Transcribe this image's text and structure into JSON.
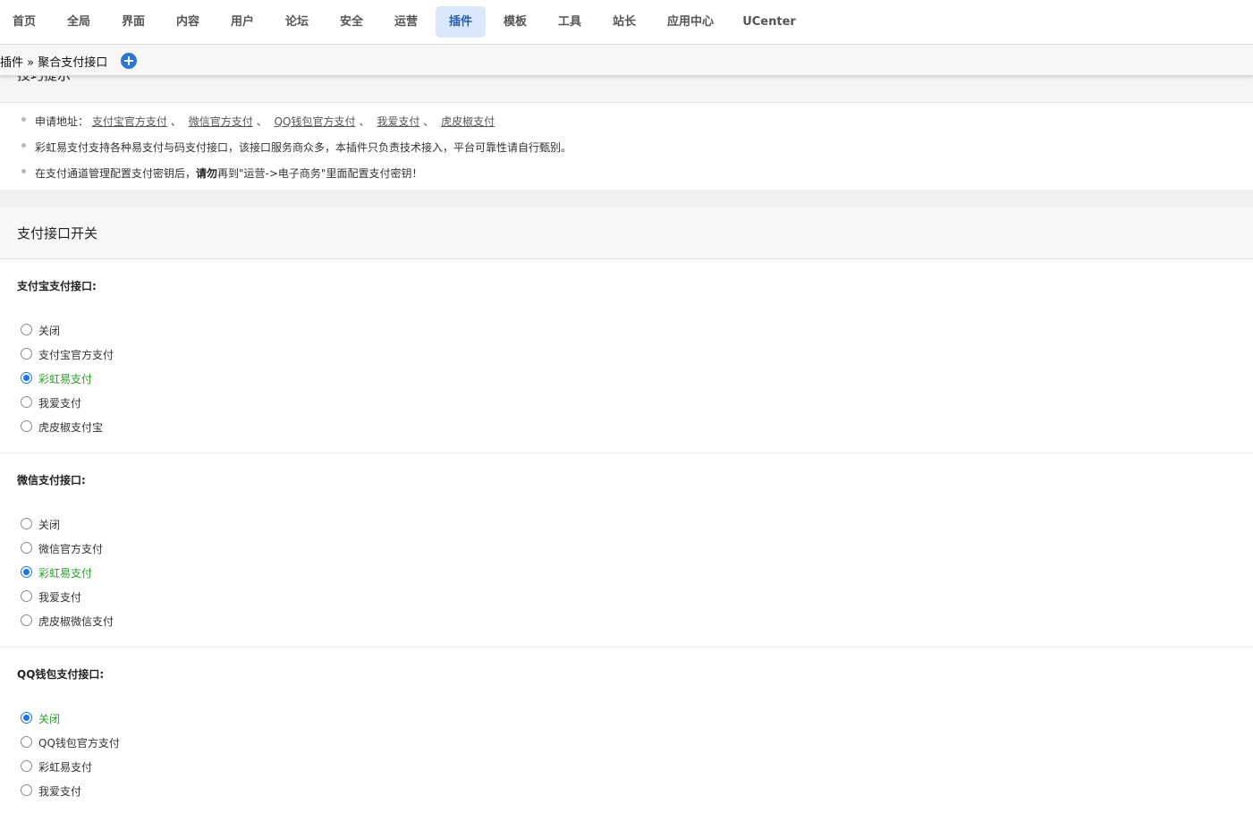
{
  "nav": {
    "items": [
      {
        "label": "首页",
        "active": false
      },
      {
        "label": "全局",
        "active": false
      },
      {
        "label": "界面",
        "active": false
      },
      {
        "label": "内容",
        "active": false
      },
      {
        "label": "用户",
        "active": false
      },
      {
        "label": "论坛",
        "active": false
      },
      {
        "label": "安全",
        "active": false
      },
      {
        "label": "运营",
        "active": false
      },
      {
        "label": "插件",
        "active": true
      },
      {
        "label": "模板",
        "active": false
      },
      {
        "label": "工具",
        "active": false
      },
      {
        "label": "站长",
        "active": false
      },
      {
        "label": "应用中心",
        "active": false
      },
      {
        "label": "UCenter",
        "active": false
      }
    ]
  },
  "breadcrumb": {
    "text": "插件 » 聚合支付接口",
    "add_icon": "plus-circle-icon"
  },
  "tips": {
    "title": "技巧提示",
    "apply_prefix": "申请地址：",
    "apply_links": [
      "支付宝官方支付",
      "微信官方支付",
      "QQ钱包官方支付",
      "我爱支付",
      "虎皮椒支付"
    ],
    "link_separator": "、",
    "note2": "彩虹易支付支持各种易支付与码支付接口，该接口服务商众多，本插件只负责技术接入，平台可靠性请自行甄别。",
    "note3_pre": "在支付通道管理配置支付密钥后，",
    "note3_bold": "请勿",
    "note3_post": "再到\"运营->电子商务\"里面配置支付密钥！"
  },
  "section": {
    "title": "支付接口开关"
  },
  "groups": [
    {
      "label": "支付宝支付接口:",
      "options": [
        "关闭",
        "支付宝官方支付",
        "彩虹易支付",
        "我爱支付",
        "虎皮椒支付宝"
      ],
      "selected_index": 2
    },
    {
      "label": "微信支付接口:",
      "options": [
        "关闭",
        "微信官方支付",
        "彩虹易支付",
        "我爱支付",
        "虎皮椒微信支付"
      ],
      "selected_index": 2
    },
    {
      "label": "QQ钱包支付接口:",
      "options": [
        "关闭",
        "QQ钱包官方支付",
        "彩虹易支付",
        "我爱支付"
      ],
      "selected_index": 0
    }
  ],
  "colors": {
    "accent": "#1a73e8",
    "nav_active_bg": "#d9e9fb",
    "selected_label": "#2a9d2a"
  }
}
